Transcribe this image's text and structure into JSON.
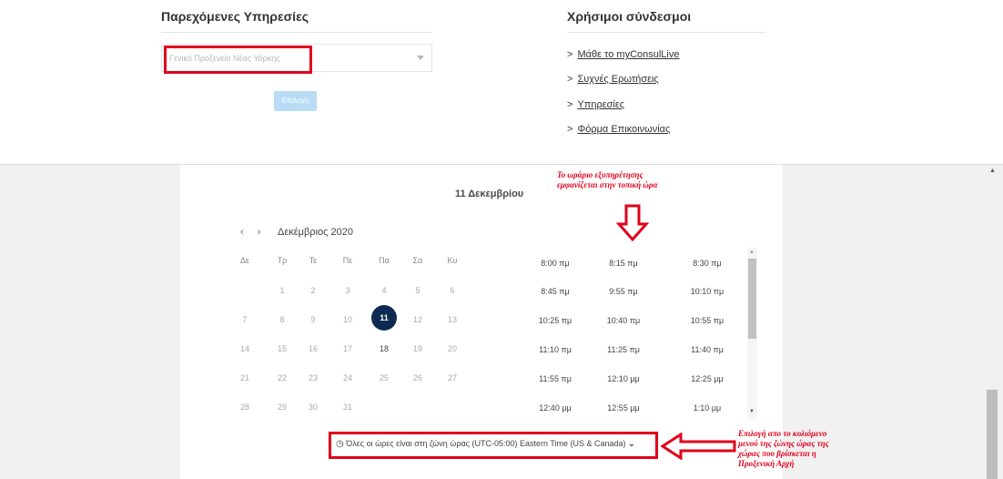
{
  "services": {
    "title": "Παρεχόμενες Υπηρεσίες",
    "select_value": "Γενικό Προξενείο Νέας Υόρκης",
    "button_label": "Επιλογή"
  },
  "useful_links": {
    "title": "Χρήσιμοι σύνδεσμοι",
    "items": [
      "Μάθε το myConsulLive",
      "Συχνές Ερωτήσεις",
      "Υπηρεσίες",
      "Φόρμα Επικοινωνίας"
    ]
  },
  "scheduler": {
    "selected_date_title": "11 Δεκεμβρίου",
    "month_label": "Δεκέμβριος 2020",
    "prev_icon": "‹",
    "next_icon": "›",
    "weekdays": [
      "Δε",
      "Τρ",
      "Τε",
      "Πε",
      "Πα",
      "Σα",
      "Κυ"
    ],
    "days": [
      "1",
      "2",
      "3",
      "4",
      "5",
      "6",
      "7",
      "8",
      "9",
      "10",
      "11",
      "12",
      "13",
      "14",
      "15",
      "16",
      "17",
      "18",
      "19",
      "20",
      "21",
      "22",
      "23",
      "24",
      "25",
      "26",
      "27",
      "28",
      "29",
      "30",
      "31"
    ],
    "selected_day": "11",
    "time_slots": [
      "8:00 πμ",
      "8:15 πμ",
      "8:30 πμ",
      "8:45 πμ",
      "9:55 πμ",
      "10:10 πμ",
      "10:25 πμ",
      "10:40 πμ",
      "10:55 πμ",
      "11:10 πμ",
      "11:25 πμ",
      "11:40 πμ",
      "11:55 πμ",
      "12:10 μμ",
      "12:25 μμ",
      "12:40 μμ",
      "12:55 μμ",
      "1:10 μμ"
    ],
    "timezone_text": "Όλες οι ώρες είναι στη ζώνη ώρας  (UTC-05:00) Eastern Time (US & Canada)"
  },
  "annotations": {
    "top_note_line1": "Το ωράριο εξυπηρέτησης",
    "top_note_line2": "εμφανίζεται στην τοπική ώρα",
    "right_note_line1": "Επιλογή απο το κυλιόμενο",
    "right_note_line2": "μενού της ζώνης ώρας της",
    "right_note_line3": "χώρας που βρίσκεται η",
    "right_note_line4": "Προξενική Αρχή"
  },
  "colors": {
    "highlight_red": "#e0001b",
    "selected_day_bg": "#0d2b52",
    "button_bg": "#b9dcf6"
  }
}
